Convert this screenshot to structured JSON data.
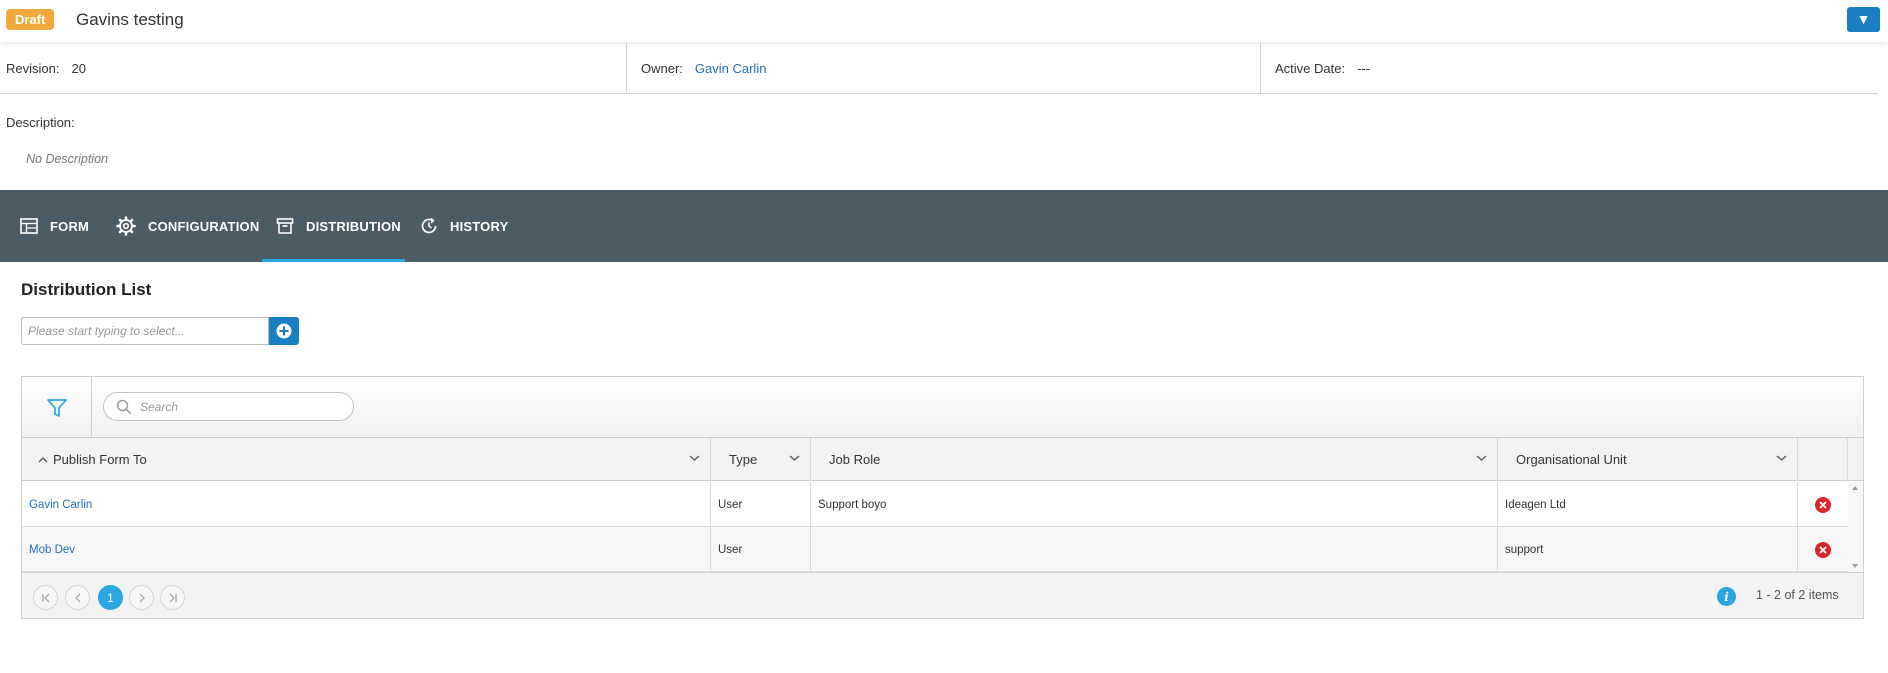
{
  "header": {
    "status_badge": "Draft",
    "title": "Gavins testing",
    "menu_icon": "▼"
  },
  "meta": {
    "revision_label": "Revision:",
    "revision_value": "20",
    "owner_label": "Owner:",
    "owner_value": "Gavin Carlin",
    "active_date_label": "Active Date:",
    "active_date_value": "---"
  },
  "description": {
    "label": "Description:",
    "value": "No Description"
  },
  "tabs": [
    {
      "label": "FORM",
      "icon": "table-icon"
    },
    {
      "label": "CONFIGURATION",
      "icon": "gear-icon"
    },
    {
      "label": "DISTRIBUTION",
      "icon": "archive-icon",
      "active": true
    },
    {
      "label": "HISTORY",
      "icon": "history-icon"
    }
  ],
  "distribution": {
    "title": "Distribution List",
    "picker_placeholder": "Please start typing to select...",
    "search_placeholder": "Search",
    "columns": [
      "Publish Form To",
      "Type",
      "Job Role",
      "Organisational Unit"
    ],
    "rows": [
      {
        "publish_to": "Gavin Carlin",
        "type": "User",
        "job_role": "Support boyo",
        "org_unit": "Ideagen Ltd"
      },
      {
        "publish_to": "Mob Dev",
        "type": "User",
        "job_role": "",
        "org_unit": "support"
      }
    ],
    "pager": {
      "current_page": "1",
      "info": "1 - 2 of 2 items"
    }
  },
  "colors": {
    "badge": "#f2a93b",
    "primary": "#1a7ec2",
    "tabbar": "#4c5c64",
    "active_tab": "#2aa6e0",
    "delete": "#d9262e",
    "link": "#2a6db5"
  }
}
